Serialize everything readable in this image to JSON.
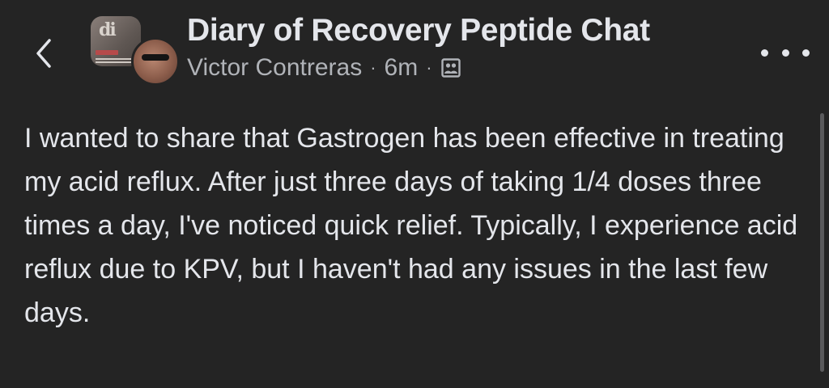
{
  "post": {
    "group_name": "Diary of Recovery Peptide Chat",
    "author": "Victor Contreras",
    "separator": "·",
    "time": "6m",
    "body": "I wanted to share that Gastrogen has been effective in treating my acid reflux. After just three days of taking 1/4 doses three times a day, I've noticed quick relief. Typically, I experience acid reflux due to KPV, but I haven't had any issues in the last few days."
  },
  "icons": {
    "back": "chevron-left-icon",
    "audience": "group-members-icon",
    "more": "more-horizontal-icon"
  },
  "colors": {
    "background": "#242424",
    "primary_text": "#e4e6eb",
    "secondary_text": "#b0b3b8"
  }
}
